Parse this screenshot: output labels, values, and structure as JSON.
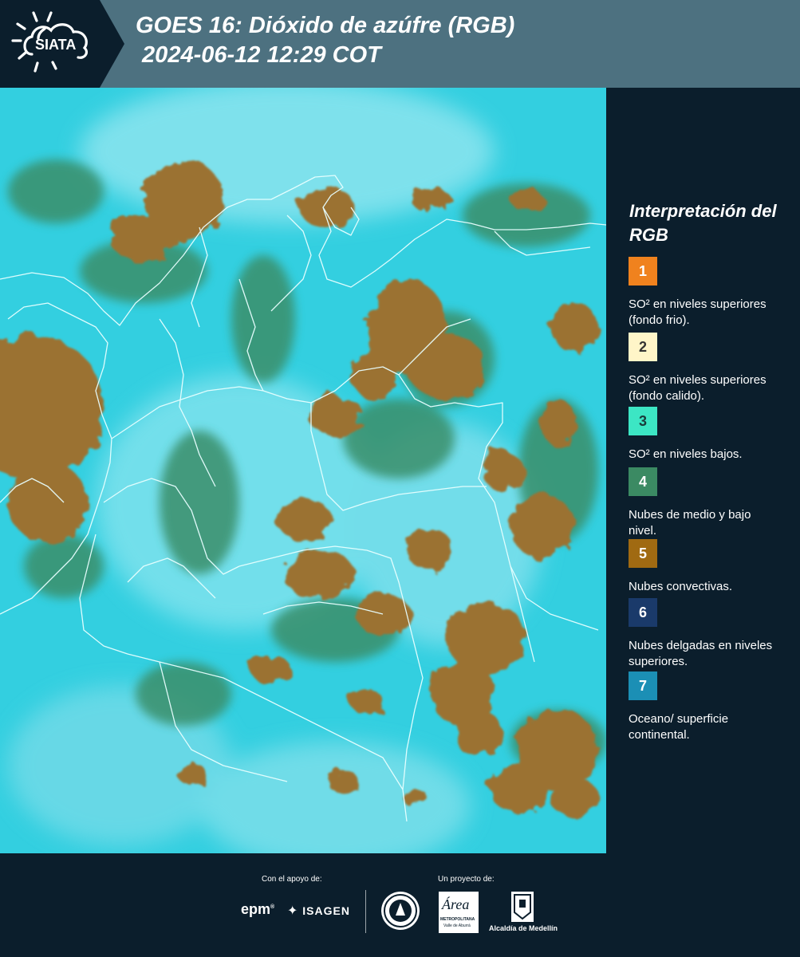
{
  "header": {
    "logo_text": "SIATA",
    "title_line1": "GOES 16: Dióxido de azúfre (RGB)",
    "title_line2": " 2024-06-12 12:29 COT"
  },
  "map": {
    "icon": "satellite-map"
  },
  "legend": {
    "title": "Interpretación del RGB",
    "items": [
      {
        "number": "1",
        "color": "#f0821e",
        "text_color": "#ffffff",
        "label": "SO² en niveles superiores (fondo frio)."
      },
      {
        "number": "2",
        "color": "#fff5c8",
        "text_color": "#333333",
        "label": "SO² en niveles superiores (fondo calido)."
      },
      {
        "number": "3",
        "color": "#3ce6c4",
        "text_color": "#1a3a3a",
        "label": "SO² en niveles bajos."
      },
      {
        "number": "4",
        "color": "#3b8a63",
        "text_color": "#ffffff",
        "label": "Nubes de medio y bajo nivel."
      },
      {
        "number": "5",
        "color": "#a06a12",
        "text_color": "#ffffff",
        "label": "Nubes convectivas."
      },
      {
        "number": "6",
        "color": "#1a3a6a",
        "text_color": "#ffffff",
        "label": "Nubes delgadas en niveles superiores."
      },
      {
        "number": "7",
        "color": "#1b8fb5",
        "text_color": "#ffffff",
        "label": "Oceano/ superficie continental."
      }
    ]
  },
  "footer": {
    "support_label": "Con el apoyo de:",
    "project_label": "Un proyecto de:",
    "sponsor_epm": "epm",
    "sponsor_isagen": "ISAGEN",
    "area_logo_text": "Área",
    "area_subtitle": "METROPOLITANA",
    "area_subtitle2": "Valle de Aburrá",
    "alcaldia": "Alcaldía de Medellín"
  },
  "colors": {
    "header_bg": "#4d7180",
    "panel_bg": "#0b1e2c",
    "map_cyan": "#35d0e0",
    "cloud_brown": "#9a7530"
  }
}
